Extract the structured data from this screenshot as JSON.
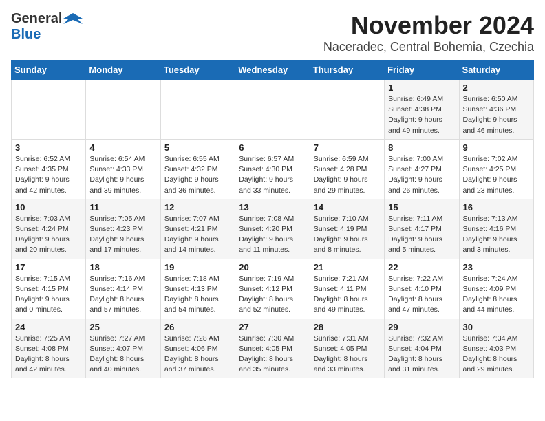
{
  "logo": {
    "general": "General",
    "blue": "Blue"
  },
  "title": "November 2024",
  "subtitle": "Naceradec, Central Bohemia, Czechia",
  "headers": [
    "Sunday",
    "Monday",
    "Tuesday",
    "Wednesday",
    "Thursday",
    "Friday",
    "Saturday"
  ],
  "weeks": [
    [
      {
        "day": "",
        "info": ""
      },
      {
        "day": "",
        "info": ""
      },
      {
        "day": "",
        "info": ""
      },
      {
        "day": "",
        "info": ""
      },
      {
        "day": "",
        "info": ""
      },
      {
        "day": "1",
        "info": "Sunrise: 6:49 AM\nSunset: 4:38 PM\nDaylight: 9 hours and 49 minutes."
      },
      {
        "day": "2",
        "info": "Sunrise: 6:50 AM\nSunset: 4:36 PM\nDaylight: 9 hours and 46 minutes."
      }
    ],
    [
      {
        "day": "3",
        "info": "Sunrise: 6:52 AM\nSunset: 4:35 PM\nDaylight: 9 hours and 42 minutes."
      },
      {
        "day": "4",
        "info": "Sunrise: 6:54 AM\nSunset: 4:33 PM\nDaylight: 9 hours and 39 minutes."
      },
      {
        "day": "5",
        "info": "Sunrise: 6:55 AM\nSunset: 4:32 PM\nDaylight: 9 hours and 36 minutes."
      },
      {
        "day": "6",
        "info": "Sunrise: 6:57 AM\nSunset: 4:30 PM\nDaylight: 9 hours and 33 minutes."
      },
      {
        "day": "7",
        "info": "Sunrise: 6:59 AM\nSunset: 4:28 PM\nDaylight: 9 hours and 29 minutes."
      },
      {
        "day": "8",
        "info": "Sunrise: 7:00 AM\nSunset: 4:27 PM\nDaylight: 9 hours and 26 minutes."
      },
      {
        "day": "9",
        "info": "Sunrise: 7:02 AM\nSunset: 4:25 PM\nDaylight: 9 hours and 23 minutes."
      }
    ],
    [
      {
        "day": "10",
        "info": "Sunrise: 7:03 AM\nSunset: 4:24 PM\nDaylight: 9 hours and 20 minutes."
      },
      {
        "day": "11",
        "info": "Sunrise: 7:05 AM\nSunset: 4:23 PM\nDaylight: 9 hours and 17 minutes."
      },
      {
        "day": "12",
        "info": "Sunrise: 7:07 AM\nSunset: 4:21 PM\nDaylight: 9 hours and 14 minutes."
      },
      {
        "day": "13",
        "info": "Sunrise: 7:08 AM\nSunset: 4:20 PM\nDaylight: 9 hours and 11 minutes."
      },
      {
        "day": "14",
        "info": "Sunrise: 7:10 AM\nSunset: 4:19 PM\nDaylight: 9 hours and 8 minutes."
      },
      {
        "day": "15",
        "info": "Sunrise: 7:11 AM\nSunset: 4:17 PM\nDaylight: 9 hours and 5 minutes."
      },
      {
        "day": "16",
        "info": "Sunrise: 7:13 AM\nSunset: 4:16 PM\nDaylight: 9 hours and 3 minutes."
      }
    ],
    [
      {
        "day": "17",
        "info": "Sunrise: 7:15 AM\nSunset: 4:15 PM\nDaylight: 9 hours and 0 minutes."
      },
      {
        "day": "18",
        "info": "Sunrise: 7:16 AM\nSunset: 4:14 PM\nDaylight: 8 hours and 57 minutes."
      },
      {
        "day": "19",
        "info": "Sunrise: 7:18 AM\nSunset: 4:13 PM\nDaylight: 8 hours and 54 minutes."
      },
      {
        "day": "20",
        "info": "Sunrise: 7:19 AM\nSunset: 4:12 PM\nDaylight: 8 hours and 52 minutes."
      },
      {
        "day": "21",
        "info": "Sunrise: 7:21 AM\nSunset: 4:11 PM\nDaylight: 8 hours and 49 minutes."
      },
      {
        "day": "22",
        "info": "Sunrise: 7:22 AM\nSunset: 4:10 PM\nDaylight: 8 hours and 47 minutes."
      },
      {
        "day": "23",
        "info": "Sunrise: 7:24 AM\nSunset: 4:09 PM\nDaylight: 8 hours and 44 minutes."
      }
    ],
    [
      {
        "day": "24",
        "info": "Sunrise: 7:25 AM\nSunset: 4:08 PM\nDaylight: 8 hours and 42 minutes."
      },
      {
        "day": "25",
        "info": "Sunrise: 7:27 AM\nSunset: 4:07 PM\nDaylight: 8 hours and 40 minutes."
      },
      {
        "day": "26",
        "info": "Sunrise: 7:28 AM\nSunset: 4:06 PM\nDaylight: 8 hours and 37 minutes."
      },
      {
        "day": "27",
        "info": "Sunrise: 7:30 AM\nSunset: 4:05 PM\nDaylight: 8 hours and 35 minutes."
      },
      {
        "day": "28",
        "info": "Sunrise: 7:31 AM\nSunset: 4:05 PM\nDaylight: 8 hours and 33 minutes."
      },
      {
        "day": "29",
        "info": "Sunrise: 7:32 AM\nSunset: 4:04 PM\nDaylight: 8 hours and 31 minutes."
      },
      {
        "day": "30",
        "info": "Sunrise: 7:34 AM\nSunset: 4:03 PM\nDaylight: 8 hours and 29 minutes."
      }
    ]
  ]
}
